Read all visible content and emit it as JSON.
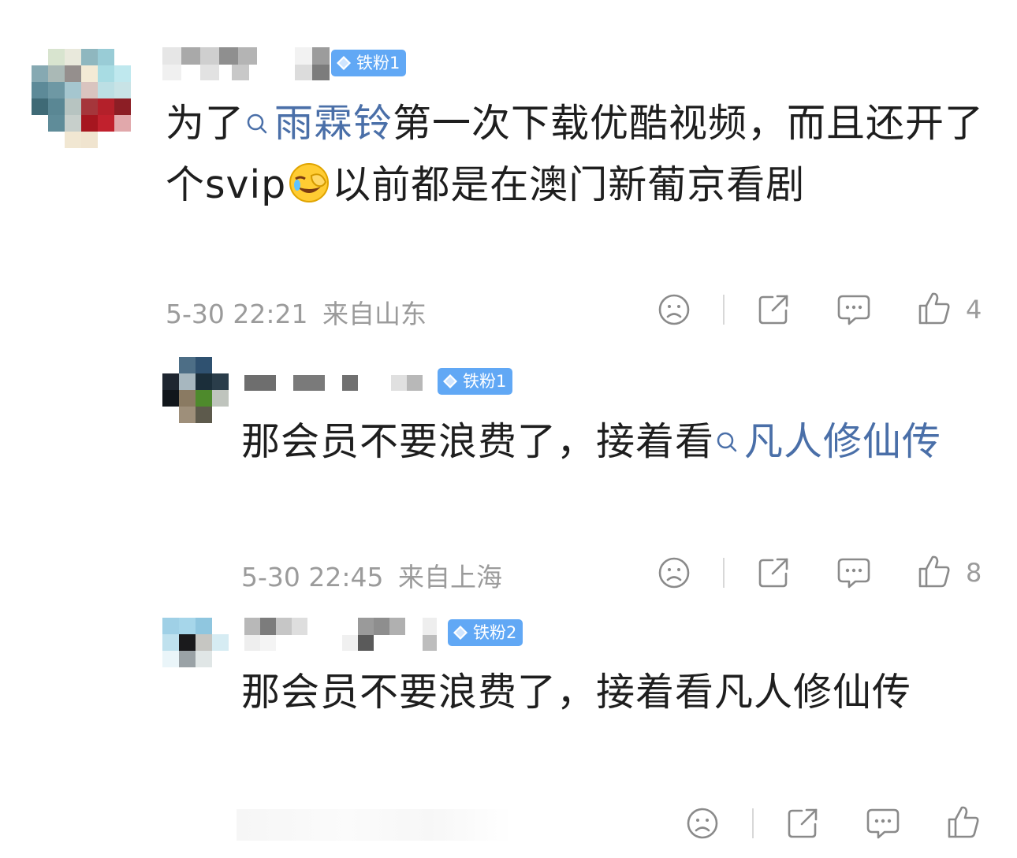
{
  "comments": [
    {
      "badge": "铁粉1",
      "text_before": "为了",
      "topic": "雨霖铃",
      "text_mid": "第一次下载优酷视频，而且还开了个svip",
      "emoji": "face-palm-laughing",
      "text_after": "以前都是在澳门新葡京看剧",
      "time": "5-30 22:21",
      "location": "来自山东",
      "likes": "4"
    },
    {
      "badge": "铁粉1",
      "text_before": "那会员不要浪费了，接着看",
      "topic": "凡人修仙传",
      "time": "5-30 22:45",
      "location": "来自上海",
      "likes": "8"
    },
    {
      "badge": "铁粉2",
      "text_before": "那会员不要浪费了，接着看凡人修仙传"
    }
  ],
  "colors": {
    "badge_bg": "#61a8f5",
    "topic": "#4a6fa8",
    "meta": "#9b9b9b",
    "icon": "#8a8a8a"
  }
}
